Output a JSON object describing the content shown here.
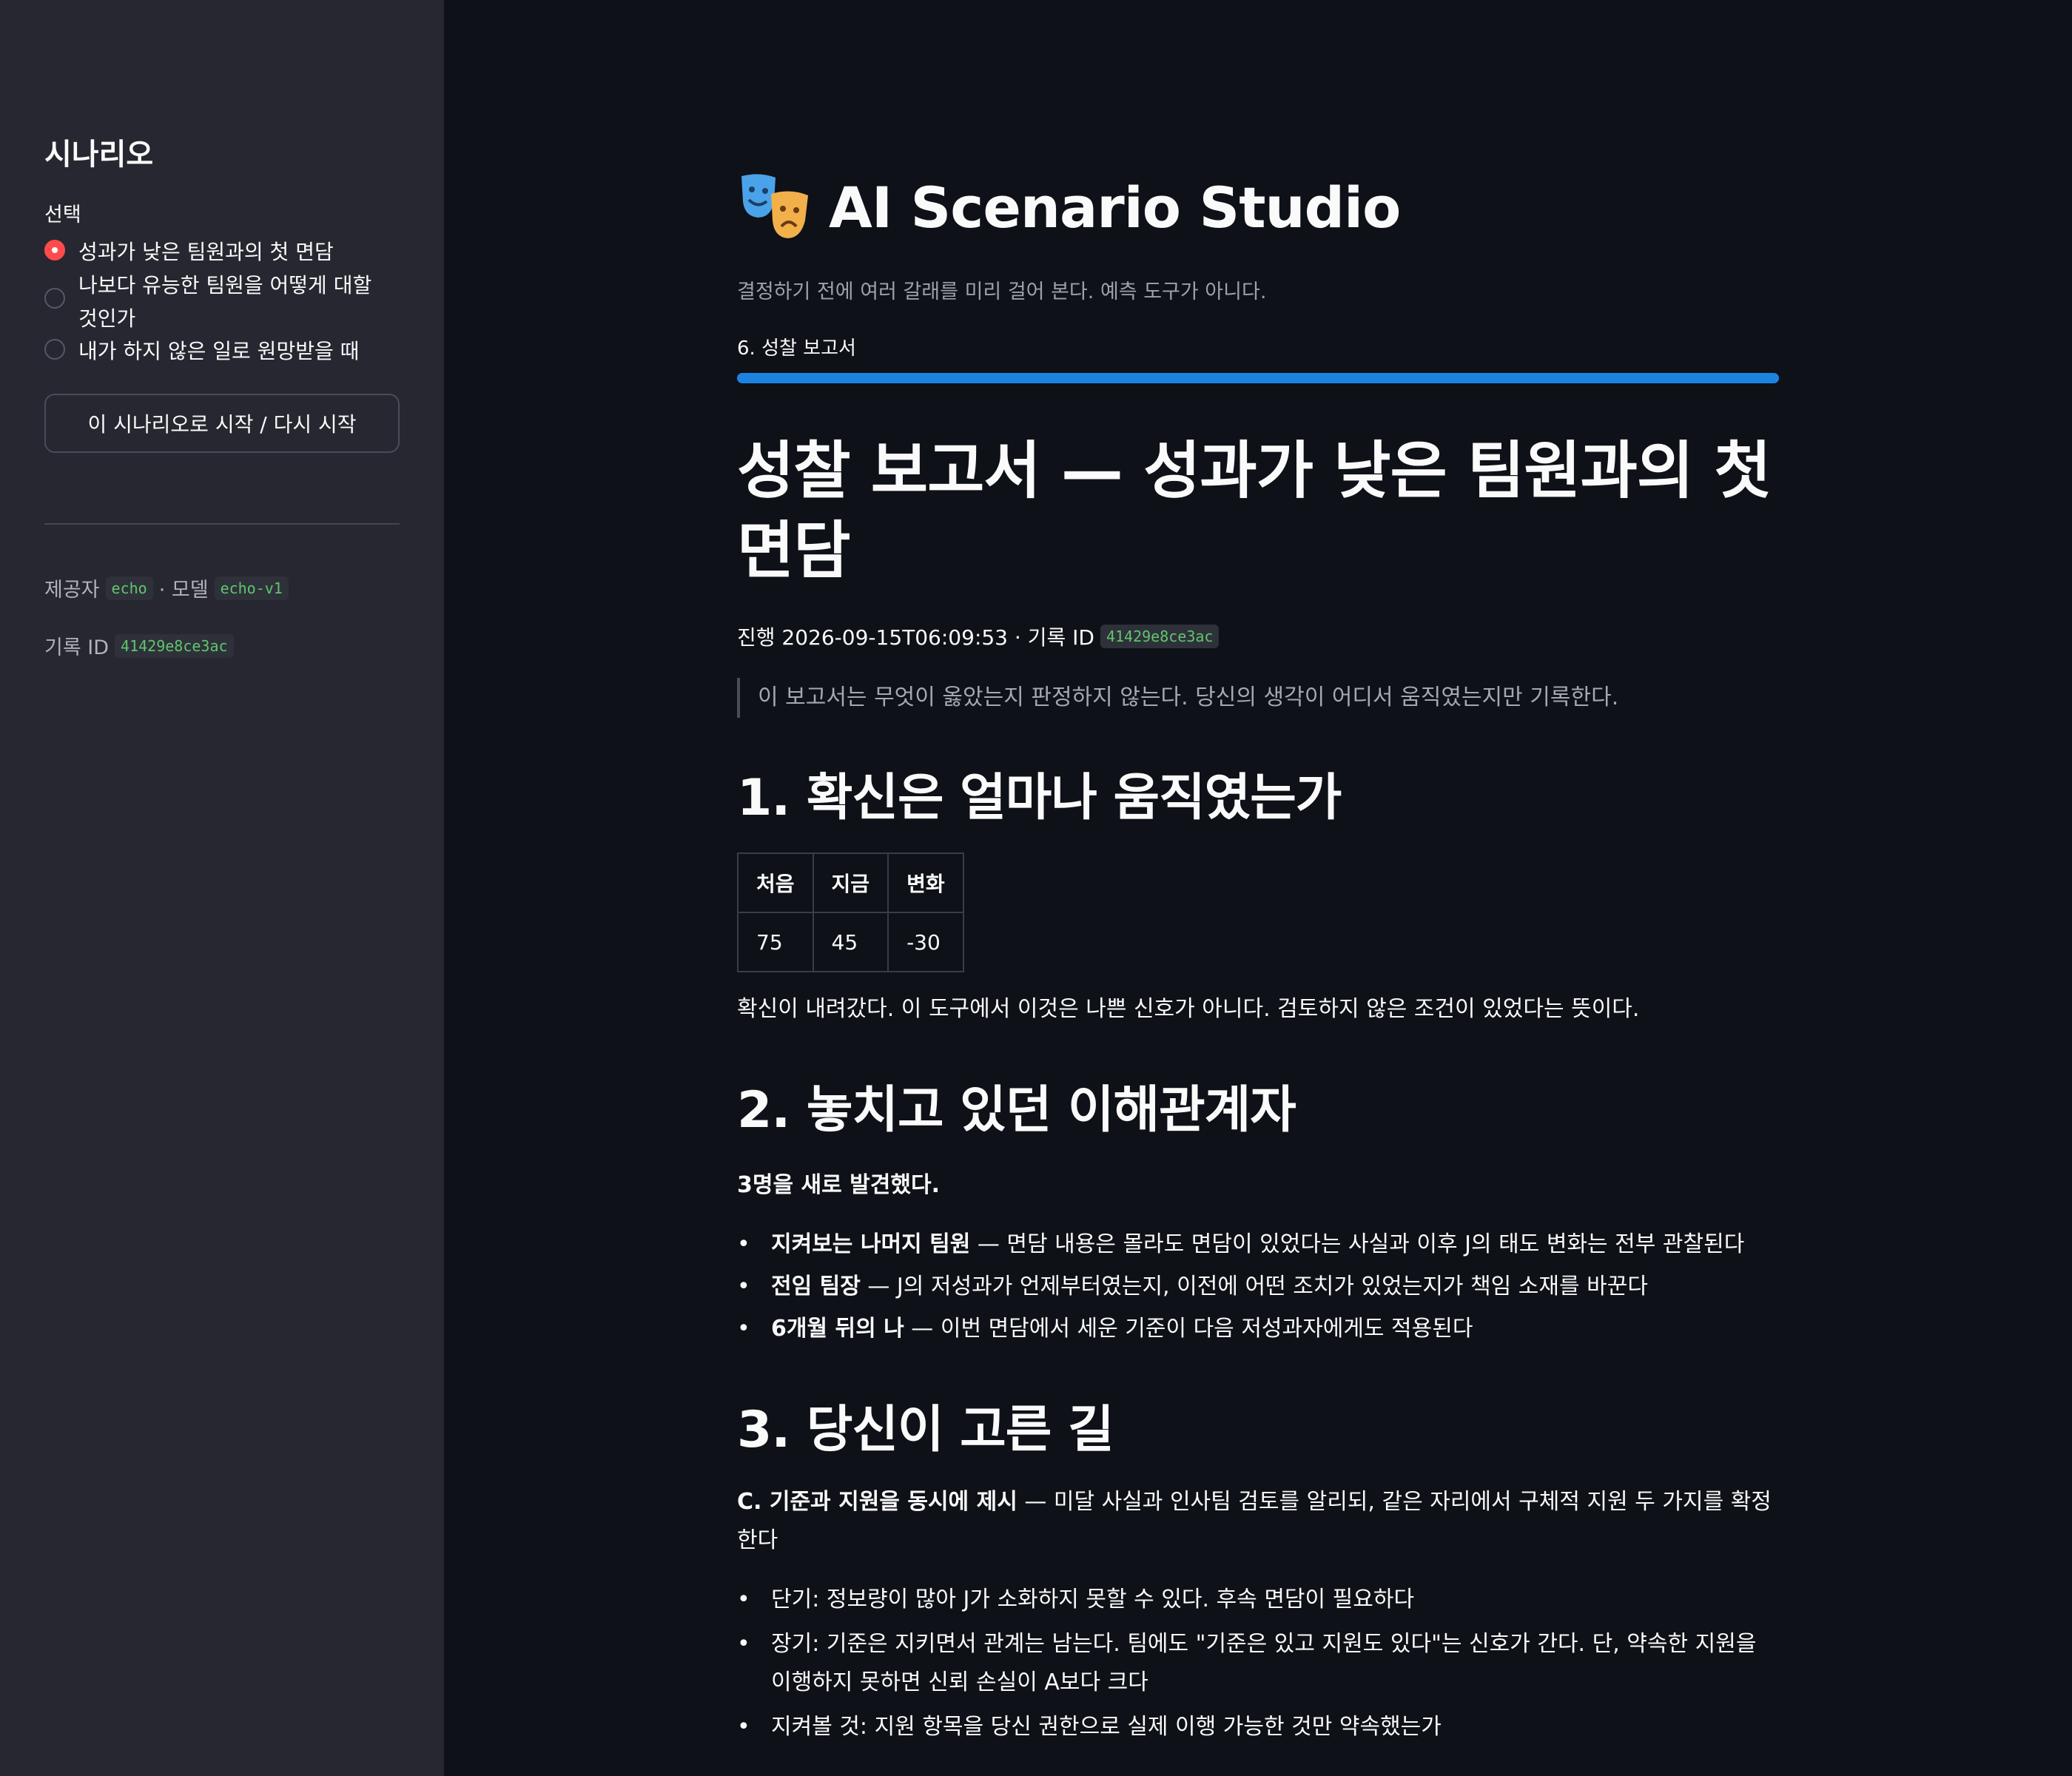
{
  "sidebar": {
    "title": "시나리오",
    "select_label": "선택",
    "options": [
      {
        "label": "성과가 낮은 팀원과의 첫 면담",
        "selected": true
      },
      {
        "label": "나보다 유능한 팀원을 어떻게 대할 것인가",
        "selected": false
      },
      {
        "label": "내가 하지 않은 일로 원망받을 때",
        "selected": false
      }
    ],
    "start_button": "이 시나리오로 시작 / 다시 시작",
    "provider_label": "제공자",
    "provider_value": "echo",
    "model_label": "· 모델",
    "model_value": "echo-v1",
    "record_label": "기록 ID",
    "record_value": "41429e8ce3ac"
  },
  "header": {
    "title": "AI Scenario Studio",
    "caption": "결정하기 전에 여러 갈래를 미리 걸어 본다. 예측 도구가 아니다.",
    "step_label": "6. 성찰 보고서",
    "progress": 1.0
  },
  "report": {
    "title": "성찰 보고서 — 성과가 낮은 팀원과의 첫 면담",
    "run_prefix": "진행 2026-09-15T06:09:53 · 기록 ID",
    "run_id": "41429e8ce3ac",
    "quote": "이 보고서는 무엇이 옳았는지 판정하지 않는다. 당신의 생각이 어디서 움직였는지만 기록한다.",
    "section1": {
      "heading": "1. 확신은 얼마나 움직였는가",
      "columns": [
        "처음",
        "지금",
        "변화"
      ],
      "values": [
        "75",
        "45",
        "-30"
      ],
      "note": "확신이 내려갔다. 이 도구에서 이것은 나쁜 신호가 아니다. 검토하지 않은 조건이 있었다는 뜻이다."
    },
    "section2": {
      "heading": "2. 놓치고 있던 이해관계자",
      "summary": "3명을 새로 발견했다.",
      "items": [
        {
          "name": "지켜보는 나머지 팀원",
          "text": " — 면담 내용은 몰라도 면담이 있었다는 사실과 이후 J의 태도 변화는 전부 관찰된다"
        },
        {
          "name": "전임 팀장",
          "text": " — J의 저성과가 언제부터였는지, 이전에 어떤 조치가 있었는지가 책임 소재를 바꾼다"
        },
        {
          "name": "6개월 뒤의 나",
          "text": " — 이번 면담에서 세운 기준이 다음 저성과자에게도 적용된다"
        }
      ]
    },
    "section3": {
      "heading": "3. 당신이 고른 길",
      "choice_name": "C. 기준과 지원을 동시에 제시",
      "choice_text": " — 미달 사실과 인사팀 검토를 알리되, 같은 자리에서 구체적 지원 두 가지를 확정한다",
      "items": [
        "단기: 정보량이 많아 J가 소화하지 못할 수 있다. 후속 면담이 필요하다",
        "장기: 기준은 지키면서 관계는 남는다. 팀에도 \"기준은 있고 지원도 있다\"는 신호가 간다. 단, 약속한 지원을 이행하지 못하면 신뢰 손실이 A보다 크다",
        "지켜볼 것: 지원 항목을 당신 권한으로 실제 이행 가능한 것만 약속했는가"
      ]
    }
  }
}
